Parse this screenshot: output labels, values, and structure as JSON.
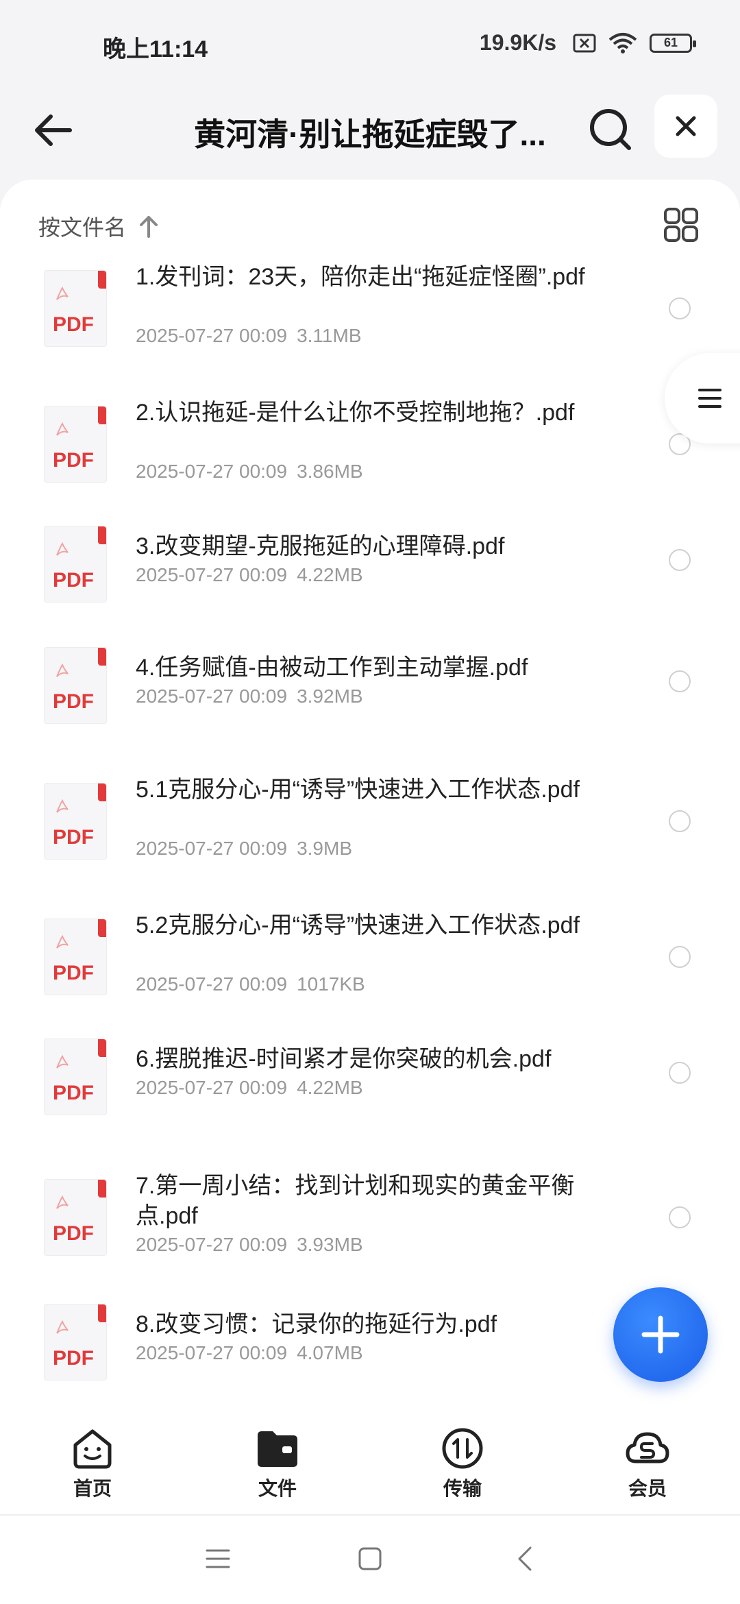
{
  "status_bar": {
    "time": "晚上11:14",
    "net_speed": "19.9K/s",
    "battery": "61"
  },
  "header": {
    "title": "黄河清·别让拖延症毁了..."
  },
  "sort": {
    "label": "按文件名"
  },
  "files": [
    {
      "name": "1.发刊词：23天，陪你走出“拖延症怪圈”.pdf",
      "date": "2025-07-27 00:09",
      "size": "3.11MB"
    },
    {
      "name": "2.认识拖延-是什么让你不受控制地拖？.pdf",
      "date": "2025-07-27 00:09",
      "size": "3.86MB"
    },
    {
      "name": "3.改变期望-克服拖延的心理障碍.pdf",
      "date": "2025-07-27 00:09",
      "size": "4.22MB"
    },
    {
      "name": "4.任务赋值-由被动工作到主动掌握.pdf",
      "date": "2025-07-27 00:09",
      "size": "3.92MB"
    },
    {
      "name": "5.1克服分心-用“诱导”快速进入工作状态.pdf",
      "date": "2025-07-27 00:09",
      "size": "3.9MB"
    },
    {
      "name": "5.2克服分心-用“诱导”快速进入工作状态.pdf",
      "date": "2025-07-27 00:09",
      "size": "1017KB"
    },
    {
      "name": "6.摆脱推迟-时间紧才是你突破的机会.pdf",
      "date": "2025-07-27 00:09",
      "size": "4.22MB"
    },
    {
      "name": "7.第一周小结：找到计划和现实的黄金平衡点.pdf",
      "date": "2025-07-27 00:09",
      "size": "3.93MB"
    },
    {
      "name": "8.改变习惯：记录你的拖延行为.pdf",
      "date": "2025-07-27 00:09",
      "size": "4.07MB"
    }
  ],
  "file_icon_label": "PDF",
  "bottom_nav": [
    {
      "label": "首页",
      "icon": "home-face-icon"
    },
    {
      "label": "文件",
      "icon": "folder-icon"
    },
    {
      "label": "传输",
      "icon": "transfer-icon"
    },
    {
      "label": "会员",
      "icon": "vip-cloud-icon"
    }
  ],
  "colors": {
    "accent": "#1a5ee8",
    "pdf_red": "#e23a3a"
  }
}
